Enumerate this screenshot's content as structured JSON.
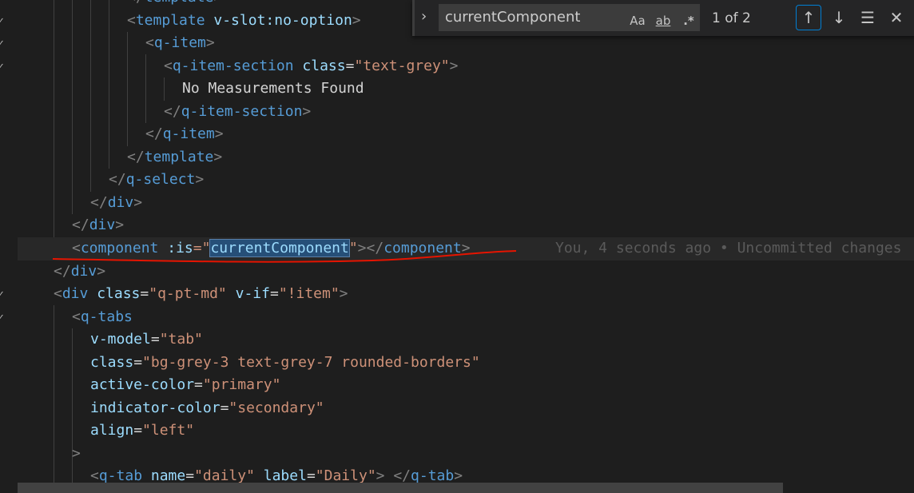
{
  "find_widget": {
    "query": "currentComponent",
    "match_case_label": "Aa",
    "whole_word_label": "ab",
    "regex_label": ".*",
    "result_count": "1 of 2",
    "icons": [
      "chevron-right-icon",
      "arrow-up-icon",
      "arrow-down-icon",
      "find-in-selection-icon",
      "close-icon"
    ]
  },
  "code": {
    "l0": {
      "a": "</",
      "b": "template",
      "c": ">"
    },
    "l1": {
      "a": "<",
      "b": "template",
      "c": " v-slot:no-option",
      "d": ">"
    },
    "l2": {
      "a": "<",
      "b": "q-item",
      "c": ">"
    },
    "l3": {
      "a": "<",
      "b": "q-item-section",
      "c": " class",
      "d": "=",
      "e": "\"text-grey\"",
      "f": ">"
    },
    "l4": {
      "a": "No Measurements Found"
    },
    "l5": {
      "a": "</",
      "b": "q-item-section",
      "c": ">"
    },
    "l6": {
      "a": "</",
      "b": "q-item",
      "c": ">"
    },
    "l7": {
      "a": "</",
      "b": "template",
      "c": ">"
    },
    "l8": {
      "a": "</",
      "b": "q-select",
      "c": ">"
    },
    "l9": {
      "a": "</",
      "b": "div",
      "c": ">"
    },
    "l10": {
      "a": "</",
      "b": "div",
      "c": ">"
    },
    "l11": {
      "a": "<",
      "b": "component",
      "c": " :is",
      "d": "=\"",
      "e": "currentComponent",
      "f": "\"",
      "g": "></",
      "h": "component",
      "i": ">"
    },
    "l11_blame": "You, 4 seconds ago • Uncommitted changes",
    "l12": {
      "a": "</",
      "b": "div",
      "c": ">"
    },
    "l13": {
      "a": "<",
      "b": "div",
      "c": " class",
      "d": "=",
      "e": "\"q-pt-md\"",
      "f": " v-if",
      "g": "=",
      "h": "\"!item\"",
      "i": ">"
    },
    "l14": {
      "a": "<",
      "b": "q-tabs"
    },
    "l15": {
      "a": "v-model",
      "b": "=",
      "c": "\"tab\""
    },
    "l16": {
      "a": "class",
      "b": "=",
      "c": "\"bg-grey-3 text-grey-7 rounded-borders\""
    },
    "l17": {
      "a": "active-color",
      "b": "=",
      "c": "\"primary\""
    },
    "l18": {
      "a": "indicator-color",
      "b": "=",
      "c": "\"secondary\""
    },
    "l19": {
      "a": "align",
      "b": "=",
      "c": "\"left\""
    },
    "l20": {
      "a": ">"
    },
    "l21": {
      "a": "<",
      "b": "q-tab",
      "c": " name",
      "d": "=",
      "e": "\"daily\"",
      "f": " label",
      "g": "=",
      "h": "\"Daily\"",
      "i": ">",
      "j": " </",
      "k": "q-tab",
      "l": ">"
    }
  },
  "gutter_checks": "✓",
  "colors": {
    "background": "#1e1e1e",
    "tag": "#569cd6",
    "attribute": "#9cdcfe",
    "string": "#ce9178",
    "annotation": "#e51400"
  }
}
